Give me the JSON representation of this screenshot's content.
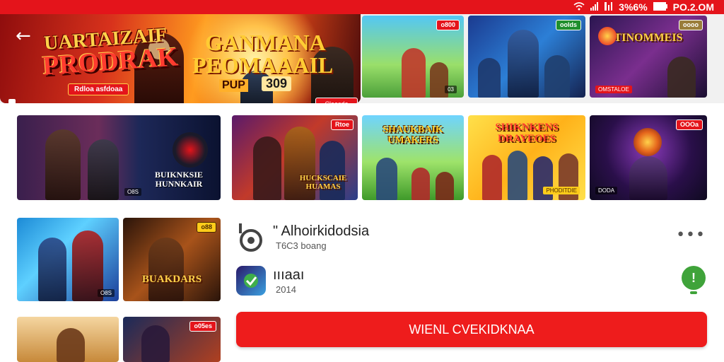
{
  "status_bar": {
    "text": "PO.2.OM",
    "battery": "3%6%",
    "icons": [
      "wifi-icon",
      "signal-icon",
      "signal-icon",
      "battery-icon"
    ]
  },
  "hero": {
    "title_line1": "UARTAIZAIF",
    "title_line2": "PRODRAK",
    "title_line3": "GANMANA",
    "title_line4": "PEOMAAAIL",
    "tag": "Rdloa asfdoaa",
    "price_left": "PUP",
    "price_right": "309",
    "corner_button": "Cloasdo",
    "back_icon": "back-arrow-icon"
  },
  "top_thumbs": [
    {
      "badge": "o800",
      "mini": "03"
    },
    {
      "badge": "oolds"
    },
    {
      "badge": "oooo",
      "caption": "TINOMMEIS",
      "mini": "OMSTALOE"
    }
  ],
  "left_grid": [
    {
      "caption": "BUIKNKSIE\nHUNNKAIR",
      "mini": "O8S"
    },
    {
      "mini": "O8S"
    },
    {
      "caption": "BUAKDARS",
      "badge": "o88"
    },
    {
      "badge": "o05es"
    },
    {}
  ],
  "middle_row": [
    {
      "badge": "Rtoe",
      "caption": "HUCKSCAIE\nHUAMAS"
    },
    {
      "caption": "SHAUKBAIK\nUMAKERS"
    },
    {
      "caption": "SHIKNKENS\nDRAYEOES",
      "mini": "PHODITDIE"
    },
    {
      "badge": "OOOa",
      "mini": "DODA"
    }
  ],
  "list": {
    "app1": {
      "title": "\" Alhoirkidodsia",
      "subtitle": "T6C3 boang",
      "menu": "•••"
    },
    "app2": {
      "title": "ıııaaı",
      "subtitle": "2014",
      "download_icon": "download-icon"
    }
  },
  "cta": {
    "label": "WIENL CVEKIDKNAA"
  },
  "colors": {
    "brand_red": "#e4141b",
    "cta_red": "#ee1c1c",
    "download_green": "#3fa33a"
  }
}
